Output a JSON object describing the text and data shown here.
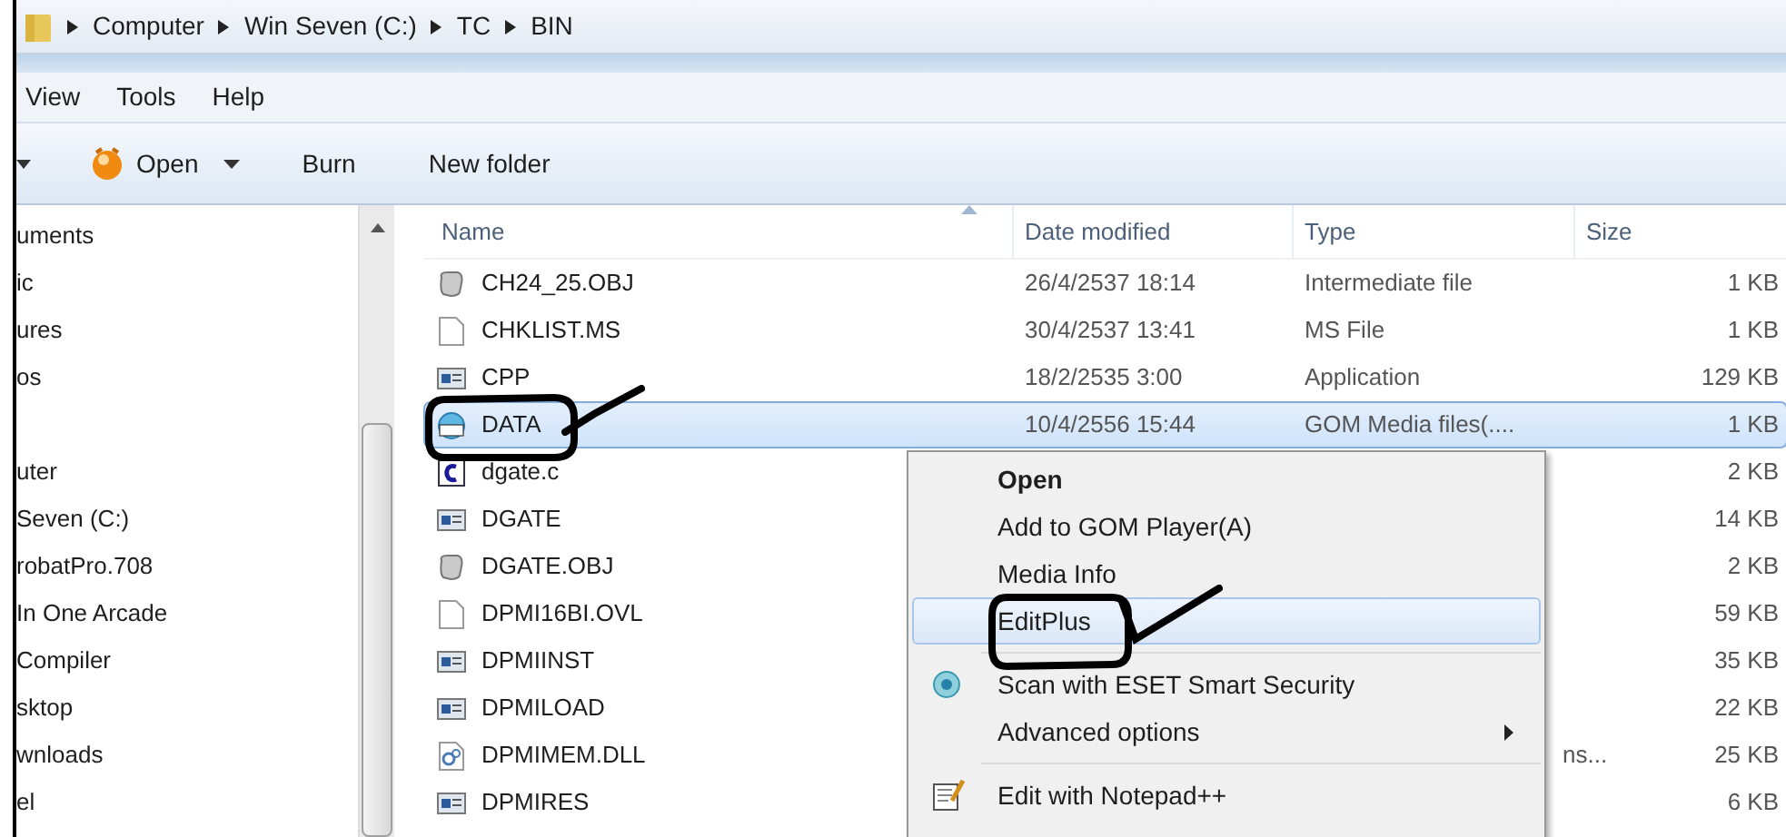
{
  "breadcrumb": [
    "Computer",
    "Win Seven (C:)",
    "TC",
    "BIN"
  ],
  "menu_bar": [
    "View",
    "Tools",
    "Help"
  ],
  "toolbar": [
    {
      "label": "Open",
      "kind": "split"
    },
    {
      "label": "Burn",
      "kind": "plain"
    },
    {
      "label": "New folder",
      "kind": "plain"
    }
  ],
  "nav_pane": {
    "items": [
      {
        "kind": "item",
        "label": "uments"
      },
      {
        "kind": "item",
        "label": "ic"
      },
      {
        "kind": "item",
        "label": "ures"
      },
      {
        "kind": "item",
        "label": "os"
      },
      {
        "kind": "spacer"
      },
      {
        "kind": "item",
        "label": "uter"
      },
      {
        "kind": "item",
        "label": "Seven (C:)"
      },
      {
        "kind": "item",
        "label": "robatPro.708"
      },
      {
        "kind": "item",
        "label": "In One Arcade"
      },
      {
        "kind": "item",
        "label": "Compiler"
      },
      {
        "kind": "item",
        "label": "sktop"
      },
      {
        "kind": "item",
        "label": "wnloads"
      },
      {
        "kind": "item",
        "label": "el"
      }
    ]
  },
  "file_list": {
    "columns": [
      "Name",
      "Date modified",
      "Type",
      "Size"
    ],
    "rows": [
      {
        "kind": "obj",
        "name": "CH24_25.OBJ",
        "date": "26/4/2537 18:14",
        "type": "Intermediate file",
        "size": "1 KB",
        "selected": false
      },
      {
        "kind": "blank",
        "name": "CHKLIST.MS",
        "date": "30/4/2537 13:41",
        "type": "MS File",
        "size": "1 KB",
        "selected": false
      },
      {
        "kind": "app",
        "name": "CPP",
        "date": "18/2/2535 3:00",
        "type": "Application",
        "size": "129 KB",
        "selected": false
      },
      {
        "kind": "gom",
        "name": "DATA",
        "date": "10/4/2556 15:44",
        "type": "GOM Media files(....",
        "size": "1 KB",
        "selected": true
      },
      {
        "kind": "c",
        "name": "dgate.c",
        "size": "2 KB",
        "selected": false
      },
      {
        "kind": "app",
        "name": "DGATE",
        "size": "14 KB",
        "selected": false
      },
      {
        "kind": "obj",
        "name": "DGATE.OBJ",
        "size": "2 KB",
        "selected": false
      },
      {
        "kind": "blank",
        "name": "DPMI16BI.OVL",
        "size": "59 KB",
        "selected": false
      },
      {
        "kind": "app",
        "name": "DPMIINST",
        "size": "35 KB",
        "selected": false
      },
      {
        "kind": "app",
        "name": "DPMILOAD",
        "size": "22 KB",
        "selected": false
      },
      {
        "kind": "dll",
        "name": "DPMIMEM.DLL",
        "type": "ns...",
        "size": "25 KB",
        "selected": false
      },
      {
        "kind": "app",
        "name": "DPMIRES",
        "size": "6 KB",
        "selected": false
      }
    ]
  },
  "context_menu": {
    "items": [
      {
        "kind": "item",
        "label": "Open",
        "default": true,
        "selected": false
      },
      {
        "kind": "item",
        "label": "Add to GOM Player(A)",
        "default": false,
        "selected": false
      },
      {
        "kind": "item",
        "label": "Media Info",
        "default": false,
        "selected": false
      },
      {
        "kind": "item",
        "label": "EditPlus",
        "default": false,
        "selected": true
      },
      {
        "kind": "separator"
      },
      {
        "kind": "eset",
        "label": "Scan with ESET Smart Security",
        "default": false,
        "selected": false
      },
      {
        "kind": "submenu",
        "label": "Advanced options",
        "default": false,
        "selected": false
      },
      {
        "kind": "separator"
      },
      {
        "kind": "notepad",
        "label": "Edit with Notepad++",
        "default": false,
        "selected": false
      }
    ]
  }
}
